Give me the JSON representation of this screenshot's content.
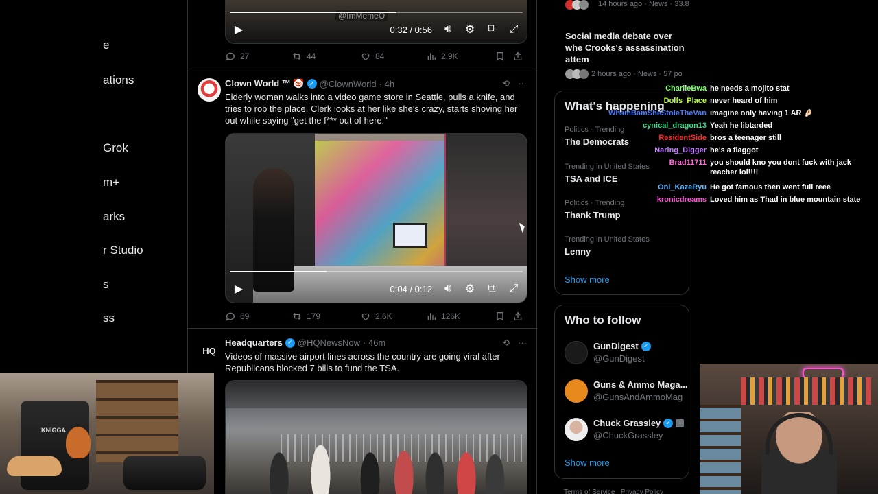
{
  "left_nav": {
    "items": [
      {
        "label": "e"
      },
      {
        "label": "ations"
      },
      {
        "label": "Grok"
      },
      {
        "label": "m+"
      },
      {
        "label": "arks"
      },
      {
        "label": "r Studio"
      },
      {
        "label": "s"
      },
      {
        "label": "ss"
      }
    ]
  },
  "top_video": {
    "watermark": "@ImMemeO",
    "time": "0:32 / 0:56",
    "progress": 0.57,
    "actions": {
      "replies": "27",
      "reposts": "44",
      "likes": "84",
      "views": "2.9K"
    }
  },
  "tweets": [
    {
      "name": "Clown World ™ 🤡",
      "handle": "@ClownWorld",
      "time": "· 4h",
      "text": "Elderly woman walks into a video game store in Seattle, pulls a knife, and tries to rob the place. Clerk looks at her like she's crazy, starts shoving her out while saying \"get the f*** out of here.\"",
      "video_time": "0:04 / 0:12",
      "video_progress": 0.33,
      "actions": {
        "replies": "69",
        "reposts": "179",
        "likes": "2.6K",
        "views": "126K"
      }
    },
    {
      "name": "Headquarters",
      "avatar_text": "HQ",
      "handle": "@HQNewsNow",
      "time": "· 46m",
      "text": "Videos of massive airport lines across the country are going viral after Republicans blocked 7 bills to fund the TSA."
    }
  ],
  "right_sidebar": {
    "news_top": {
      "meta": "14 hours ago · News · 33.8"
    },
    "news_item": {
      "title": "Social media debate over whe Crooks's assassination attem",
      "meta": "2 hours ago · News · 57 po"
    },
    "whats_happening": {
      "title": "What's happening",
      "trends": [
        {
          "meta": "Politics · Trending",
          "name": "The Democrats"
        },
        {
          "meta": "Trending in United States",
          "name": "TSA and ICE"
        },
        {
          "meta": "Politics · Trending",
          "name": "Thank Trump"
        },
        {
          "meta": "Trending in United States",
          "name": "Lenny"
        }
      ],
      "show_more": "Show more"
    },
    "who_to_follow": {
      "title": "Who to follow",
      "accounts": [
        {
          "name": "GunDigest",
          "handle": "@GunDigest"
        },
        {
          "name": "Guns & Ammo Maga...",
          "handle": "@GunsAndAmmoMag"
        },
        {
          "name": "Chuck Grassley",
          "handle": "@ChuckGrassley"
        }
      ],
      "show_more": "Show more"
    },
    "footer": "Terms of Service   Privacy Policy"
  },
  "chat": [
    {
      "user": "CharlieBwa",
      "color": "#7dff6a",
      "message": "he needs a mojito stat"
    },
    {
      "user": "Dolfs_Place",
      "color": "#b6ff3a",
      "message": "never heard of him"
    },
    {
      "user": "WhamBamSheStoleTheVan",
      "color": "#4d7dff",
      "message": "imagine only having 1 AR 🤌🏻"
    },
    {
      "user": "cynical_dragon13",
      "color": "#39d98a",
      "message": "Yeah he libtarded"
    },
    {
      "user": "ResidentSide",
      "color": "#ff2a2a",
      "message": "bros a teenager still"
    },
    {
      "user": "Naring_Digger",
      "color": "#c07bff",
      "message": "he's a flaggot"
    },
    {
      "user": "Brad11711",
      "color": "#ff6ad5",
      "message": "you should kno you dont fuck with jack reacher lol!!!!"
    },
    {
      "user": "Oni_KazeRyu",
      "color": "#5fb8ff",
      "message": "He got famous then went full reee"
    },
    {
      "user": "kronicdreams",
      "color": "#ff4fd8",
      "message": "Loved him as Thad in blue mountain state"
    }
  ],
  "webcam_left": {
    "label": "KNIGGA"
  },
  "colors": {
    "accent": "#1d9bf0",
    "bg": "#000000",
    "border": "#2f3336",
    "muted": "#71767b"
  }
}
